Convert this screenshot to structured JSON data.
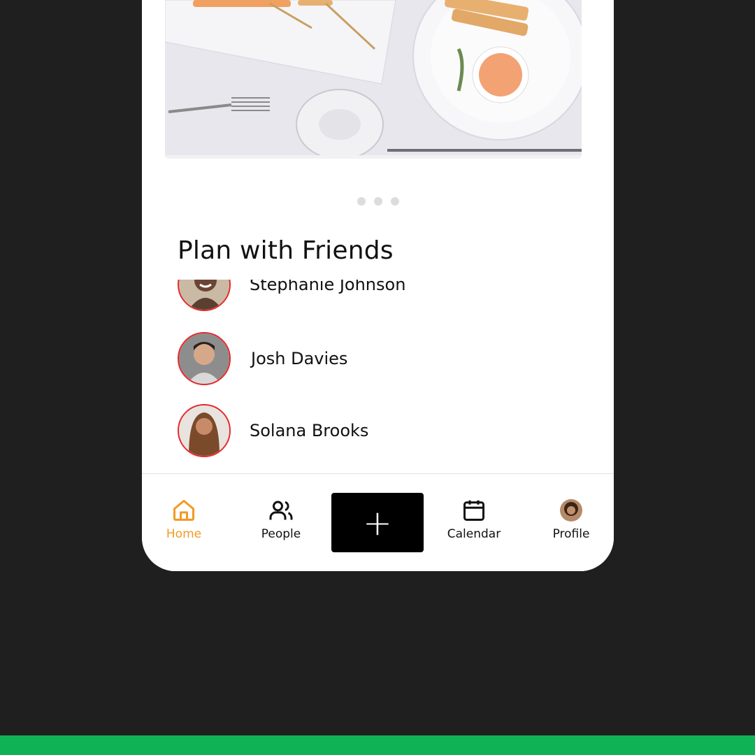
{
  "carousel": {
    "dots": 3
  },
  "section": {
    "title": "Plan with Friends"
  },
  "friends": [
    {
      "name": "Stephanie Johnson",
      "avatar_icon": "person-photo"
    },
    {
      "name": "Josh Davies",
      "avatar_icon": "person-photo"
    },
    {
      "name": "Solana Brooks",
      "avatar_icon": "person-photo"
    }
  ],
  "nav": {
    "home": "Home",
    "people": "People",
    "add": "+",
    "calendar": "Calendar",
    "profile": "Profile"
  },
  "colors": {
    "accent": "#f39a24",
    "avatar_ring": "#e8282b",
    "background": "#1f1f1f",
    "footer_bar": "#0fb356"
  }
}
